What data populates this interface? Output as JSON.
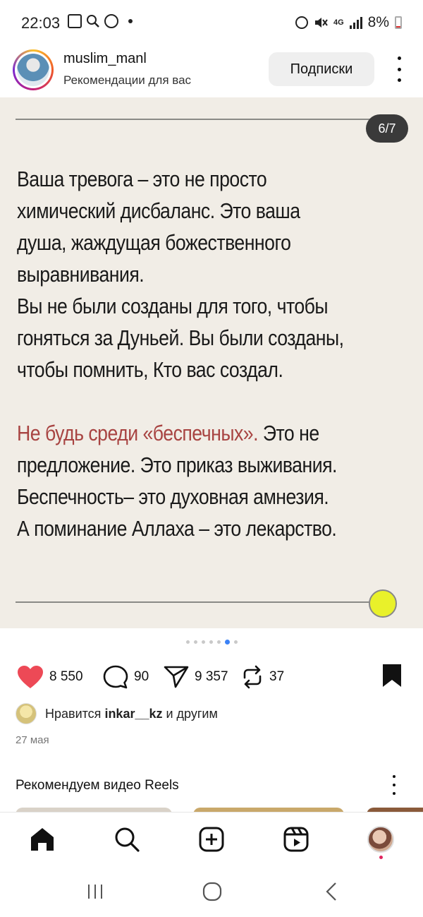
{
  "status_bar": {
    "time": "22:03",
    "network": "4G",
    "battery": "8%",
    "left_icons": [
      "gallery-icon",
      "search-icon",
      "pinterest-icon"
    ],
    "right_icons": [
      "alarm-icon",
      "mute-icon",
      "signal-icon",
      "battery-icon"
    ]
  },
  "header": {
    "username": "muslim_manl",
    "subtitle": "Рекомендации для вас",
    "follow_label": "Подписки"
  },
  "post": {
    "counter": "6/7",
    "paragraph1": [
      "Ваша тревога – это не просто",
      "химический дисбаланс. Это ваша",
      "душа, жаждущая божественного",
      "выравнивания.",
      "Вы не были созданы для того, чтобы",
      "гоняться за Дуньей. Вы были созданы,",
      "чтобы помнить, Кто вас создал."
    ],
    "paragraph2_highlight": "Не будь среди «беспечных».",
    "paragraph2_rest_first": " Это не",
    "paragraph2": [
      "предложение. Это приказ выживания.",
      "Беспечность– это духовная амнезия.",
      "А поминание Аллаха – это лекарство."
    ],
    "highlight_color": "#a84442",
    "background_color": "#f1ede6"
  },
  "carousel": {
    "total": 7,
    "active_index": 5
  },
  "actions": {
    "likes": "8 550",
    "comments": "90",
    "shares": "9 357",
    "reposts": "37"
  },
  "likes_line": {
    "prefix": "Нравится ",
    "user": "inkar__kz",
    "suffix": " и другим"
  },
  "date": "27 мая",
  "reels": {
    "title": "Рекомендуем видео Reels"
  },
  "bottom_nav": [
    "home-icon",
    "search-icon",
    "create-icon",
    "reels-icon",
    "profile-avatar"
  ],
  "colors": {
    "like": "#ed4956",
    "active_dot": "#3b82f6",
    "badge": "#3a3a3a"
  }
}
